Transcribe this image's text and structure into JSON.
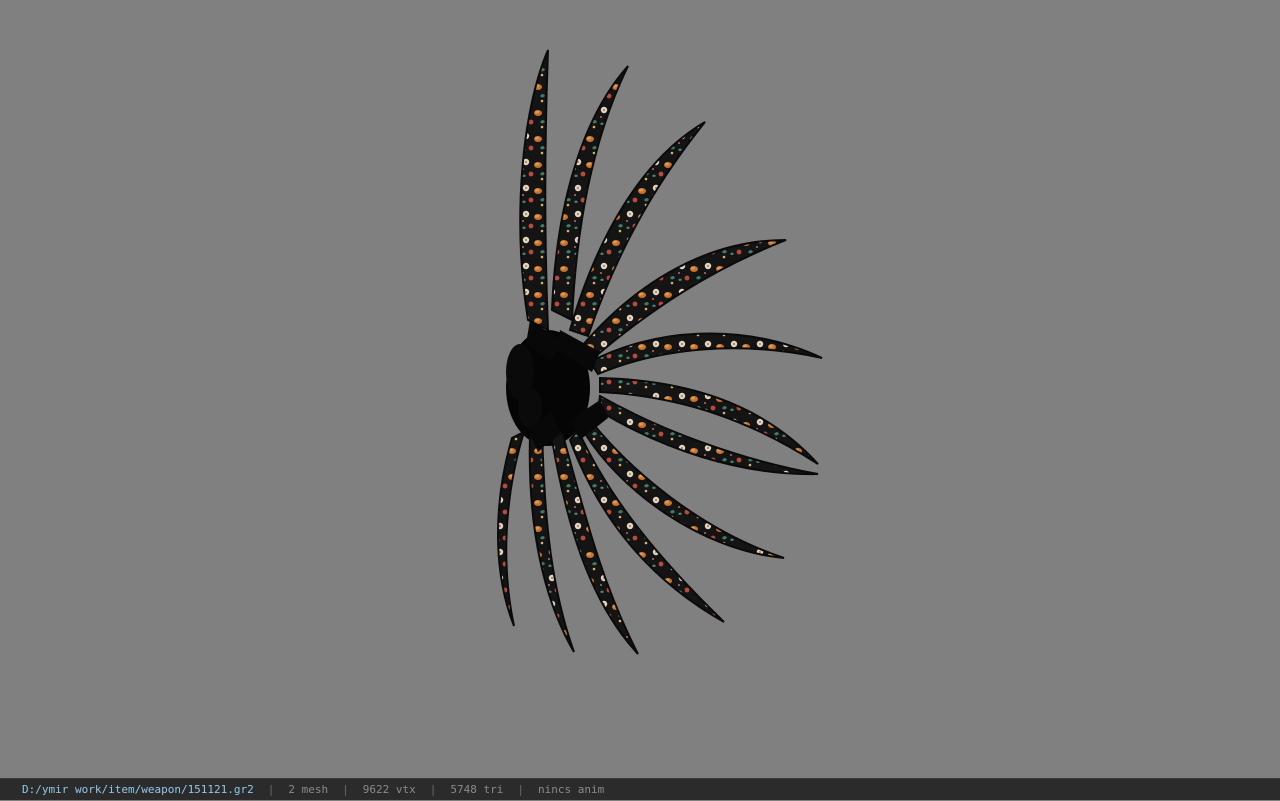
{
  "status_bar": {
    "file_path": "D:/ymir work/item/weapon/151121.gr2",
    "mesh": "2 mesh",
    "vertices": "9622 vtx",
    "triangles": "5748 tri",
    "animation": "nincs anim"
  },
  "colors": {
    "background": "#808080",
    "status_bar_bg": "#2b2b2b",
    "path_text": "#8fc8e8",
    "info_text": "#8a8a8a"
  }
}
